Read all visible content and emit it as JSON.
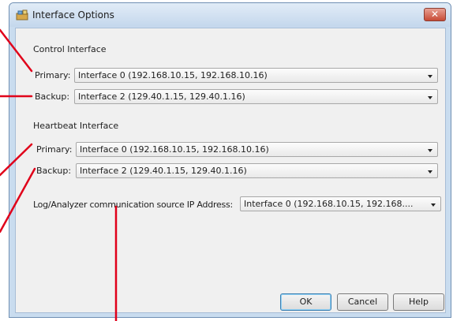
{
  "window": {
    "title": "Interface Options",
    "close_label": "✕"
  },
  "control": {
    "heading": "Control Interface",
    "primary_label": "Primary:",
    "primary_value": "Interface 0 (192.168.10.15, 192.168.10.16)",
    "backup_label": "Backup:",
    "backup_value": "Interface 2 (129.40.1.15, 129.40.1.16)"
  },
  "heartbeat": {
    "heading": "Heartbeat Interface",
    "primary_label": "Primary:",
    "primary_value": "Interface 0 (192.168.10.15, 192.168.10.16)",
    "backup_label": "Backup:",
    "backup_value": "Interface 2 (129.40.1.15, 129.40.1.16)"
  },
  "log": {
    "label": "Log/Analyzer communication source IP Address:",
    "value": "Interface 0 (192.168.10.15, 192.168...."
  },
  "buttons": {
    "ok": "OK",
    "cancel": "Cancel",
    "help": "Help"
  },
  "colors": {
    "annotation": "#e0001a",
    "titlebar": "#c9dcef"
  }
}
